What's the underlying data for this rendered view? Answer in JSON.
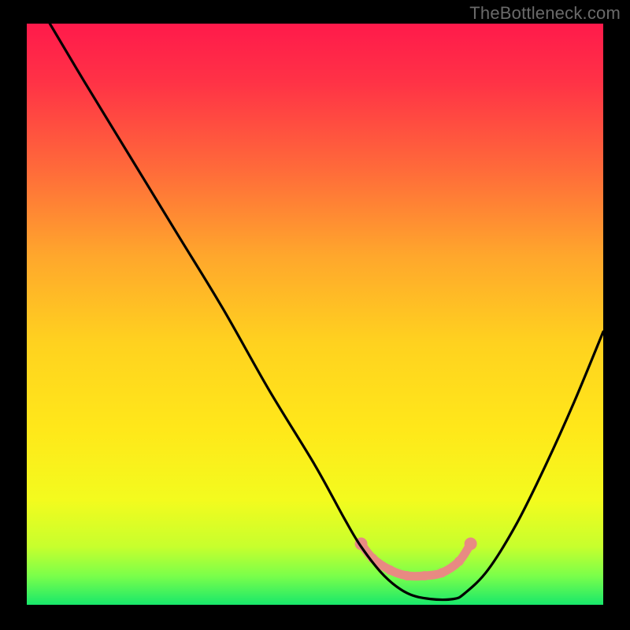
{
  "watermark": "TheBottleneck.com",
  "chart_data": {
    "type": "line",
    "title": "",
    "xlabel": "",
    "ylabel": "",
    "xlim": [
      0,
      100
    ],
    "ylim": [
      0,
      100
    ],
    "grid": false,
    "background_gradient": {
      "stops": [
        {
          "offset": 0.0,
          "color": "#ff1a4b"
        },
        {
          "offset": 0.1,
          "color": "#ff3246"
        },
        {
          "offset": 0.25,
          "color": "#ff6a3a"
        },
        {
          "offset": 0.4,
          "color": "#ffa72c"
        },
        {
          "offset": 0.55,
          "color": "#ffd21f"
        },
        {
          "offset": 0.7,
          "color": "#ffe81a"
        },
        {
          "offset": 0.82,
          "color": "#f3fb1e"
        },
        {
          "offset": 0.9,
          "color": "#c7ff2d"
        },
        {
          "offset": 0.95,
          "color": "#7bff4a"
        },
        {
          "offset": 1.0,
          "color": "#18e86b"
        }
      ]
    },
    "series": [
      {
        "name": "bottleneck-curve",
        "color": "#000000",
        "x": [
          4,
          10,
          18,
          26,
          34,
          42,
          50,
          55,
          58,
          62,
          66,
          70,
          74,
          76,
          80,
          85,
          90,
          95,
          100
        ],
        "y": [
          100,
          90,
          77,
          64,
          51,
          37,
          24,
          15,
          10,
          5,
          2,
          1,
          1,
          2,
          6,
          14,
          24,
          35,
          47
        ]
      }
    ],
    "annotations": {
      "highlight_band": {
        "color": "#e88a82",
        "points_x": [
          58,
          60,
          63,
          66,
          69,
          72,
          75,
          77
        ],
        "points_y": [
          10.5,
          8.0,
          6.0,
          5.0,
          5.0,
          5.5,
          7.5,
          10.5
        ]
      }
    }
  }
}
